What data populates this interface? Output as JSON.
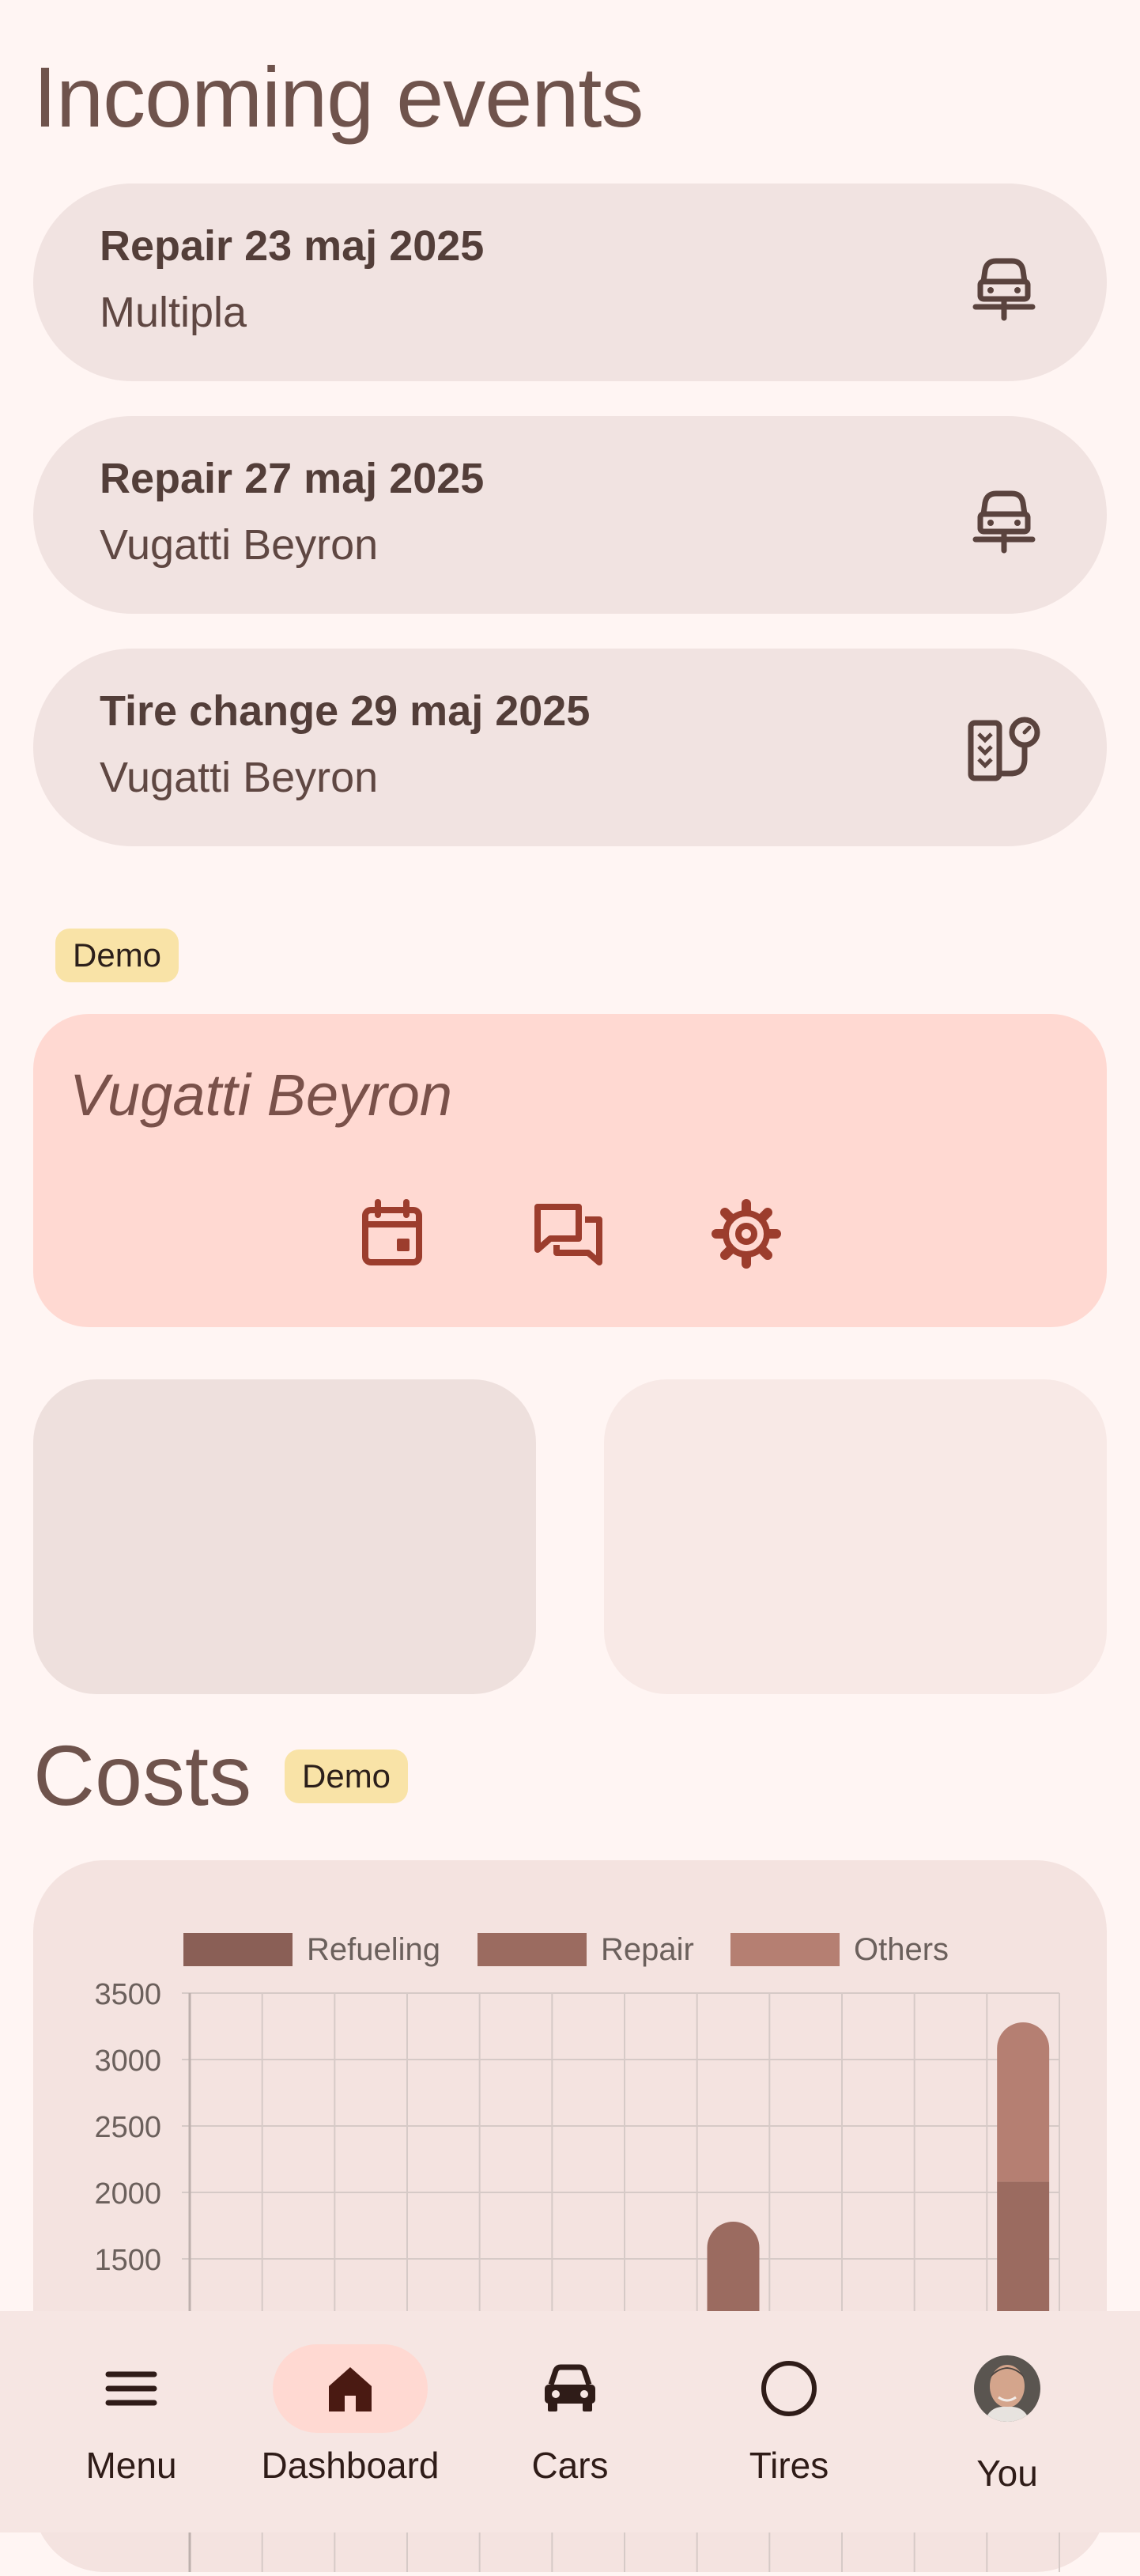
{
  "incoming": {
    "title": "Incoming events",
    "events": [
      {
        "title": "Repair 23 maj 2025",
        "car": "Multipla",
        "icon": "car-front-icon"
      },
      {
        "title": "Repair 27 maj 2025",
        "car": "Vugatti Beyron",
        "icon": "car-front-icon"
      },
      {
        "title": "Tire change 29 maj 2025",
        "car": "Vugatti Beyron",
        "icon": "tire-change-icon"
      }
    ]
  },
  "car_section": {
    "badge": "Demo",
    "car_name": "Vugatti Beyron",
    "actions": [
      "calendar-icon",
      "chat-icon",
      "gear-icon"
    ]
  },
  "costs": {
    "title": "Costs",
    "badge": "Demo"
  },
  "chart_data": {
    "type": "bar",
    "stacked": true,
    "legend": [
      "Refueling",
      "Repair",
      "Others"
    ],
    "legend_position": "top",
    "y_ticks_visible": [
      "3500",
      "3000",
      "2500",
      "2000",
      "1500"
    ],
    "ylim": [
      1000,
      3500
    ],
    "grid": true,
    "visible_bars": [
      {
        "column": 8,
        "series": [
          {
            "name": "Repair",
            "value": 1780
          }
        ]
      },
      {
        "column": 12,
        "series": [
          {
            "name": "Repair",
            "value": 2080
          },
          {
            "name": "Others",
            "value": 1200
          }
        ]
      }
    ],
    "colors": {
      "Refueling": "#8a5f56",
      "Repair": "#9b6b60",
      "Others": "#b57f72"
    }
  },
  "nav": {
    "items": [
      {
        "label": "Menu",
        "icon": "hamburger-menu-icon"
      },
      {
        "label": "Dashboard",
        "icon": "home-icon"
      },
      {
        "label": "Cars",
        "icon": "car-icon"
      },
      {
        "label": "Tires",
        "icon": "tire-circle-icon"
      },
      {
        "label": "You",
        "icon": "avatar"
      }
    ],
    "active": "Dashboard"
  },
  "colors": {
    "background": "#fff5f3",
    "card": "#f1e3e1",
    "accent_card": "#ffd9d2",
    "badge": "#f9e3a7",
    "icon_accent": "#9c3d2d"
  }
}
